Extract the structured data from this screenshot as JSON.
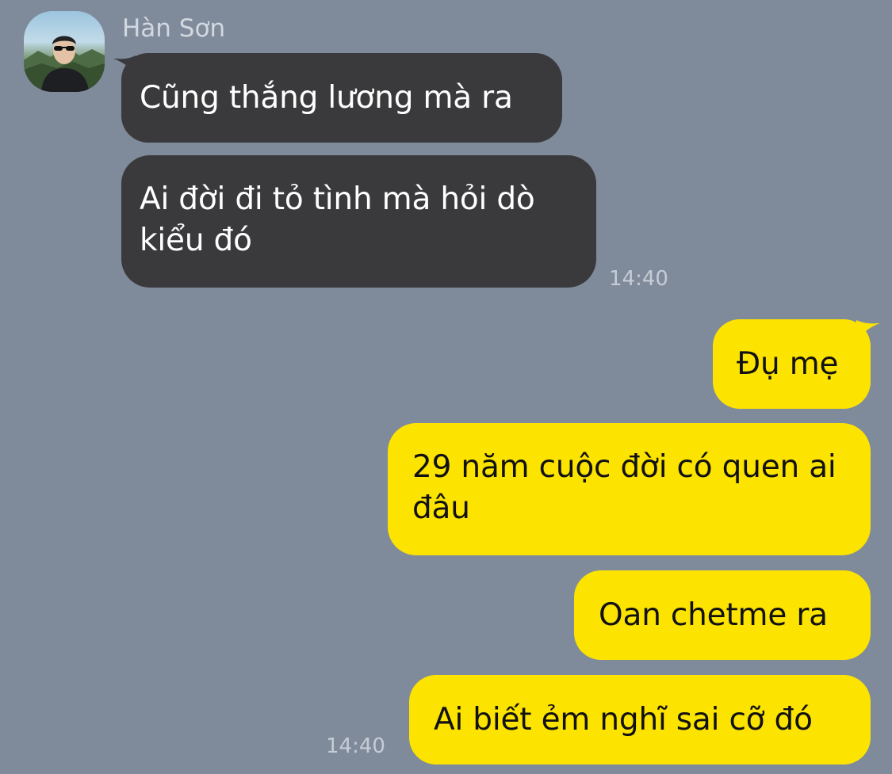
{
  "chat": {
    "contact": {
      "name": "Hàn Sơn",
      "avatar_icon": "profile-photo"
    },
    "incoming": {
      "messages": [
        "Cũng thắng lương mà ra",
        "Ai đời đi tỏ tình mà hỏi dò kiểu đó"
      ],
      "time": "14:40"
    },
    "outgoing": {
      "messages": [
        "Đụ mẹ",
        "29 năm cuộc đời có quen ai đâu",
        "Oan chetme ra",
        "Ai biết ẻm nghĩ sai cỡ đó"
      ],
      "time": "14:40"
    },
    "colors": {
      "background": "#7f8a9b",
      "incoming_bubble": "#3a3a3c",
      "outgoing_bubble": "#fce300"
    }
  }
}
